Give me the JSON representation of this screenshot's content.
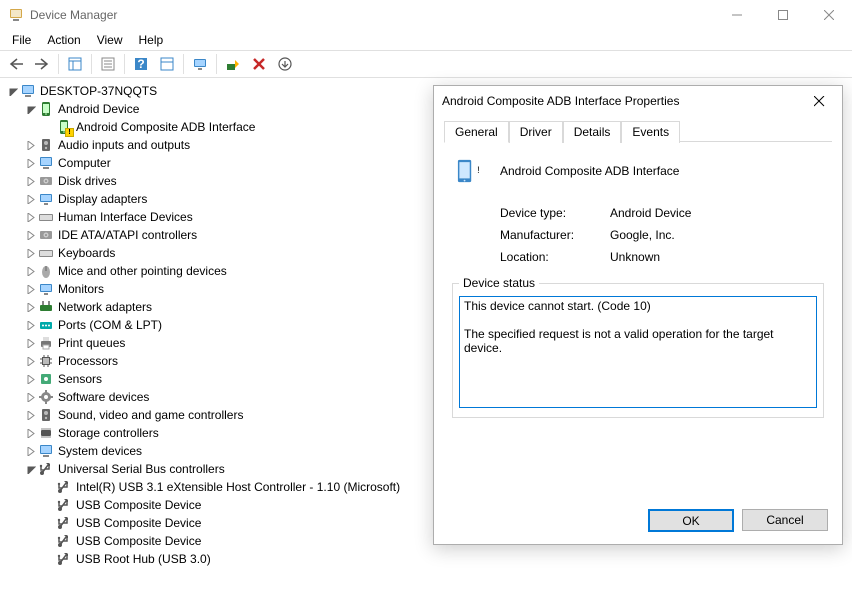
{
  "window": {
    "title": "Device Manager"
  },
  "menubar": {
    "items": [
      "File",
      "Action",
      "View",
      "Help"
    ]
  },
  "tree": {
    "root": "DESKTOP-37NQQTS",
    "cat_android": "Android Device",
    "android_child": "Android Composite ADB Interface",
    "cat_audio": "Audio inputs and outputs",
    "cat_computer": "Computer",
    "cat_disk": "Disk drives",
    "cat_display": "Display adapters",
    "cat_hid": "Human Interface Devices",
    "cat_ide": "IDE ATA/ATAPI controllers",
    "cat_kbd": "Keyboards",
    "cat_mice": "Mice and other pointing devices",
    "cat_monitors": "Monitors",
    "cat_net": "Network adapters",
    "cat_ports": "Ports (COM & LPT)",
    "cat_print": "Print queues",
    "cat_proc": "Processors",
    "cat_sensors": "Sensors",
    "cat_sw": "Software devices",
    "cat_sound": "Sound, video and game controllers",
    "cat_storage": "Storage controllers",
    "cat_system": "System devices",
    "cat_usb": "Universal Serial Bus controllers",
    "usb0": "Intel(R) USB 3.1 eXtensible Host Controller - 1.10 (Microsoft)",
    "usb1": "USB Composite Device",
    "usb2": "USB Composite Device",
    "usb3": "USB Composite Device",
    "usb4": "USB Root Hub (USB 3.0)"
  },
  "dialog": {
    "title": "Android Composite ADB Interface Properties",
    "tabs": {
      "general": "General",
      "driver": "Driver",
      "details": "Details",
      "events": "Events"
    },
    "device_name": "Android Composite ADB Interface",
    "labels": {
      "type": "Device type:",
      "mfr": "Manufacturer:",
      "loc": "Location:",
      "status_group": "Device status"
    },
    "values": {
      "type": "Android Device",
      "mfr": "Google, Inc.",
      "loc": "Unknown"
    },
    "status_text": "This device cannot start. (Code 10)\n\nThe specified request is not a valid operation for the target device.",
    "buttons": {
      "ok": "OK",
      "cancel": "Cancel"
    }
  }
}
